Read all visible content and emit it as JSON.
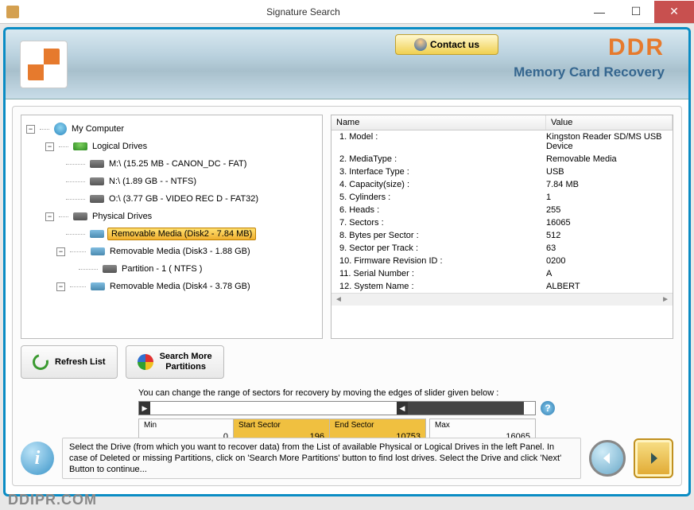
{
  "window": {
    "title": "Signature Search"
  },
  "header": {
    "contact_label": "Contact us",
    "brand": "DDR",
    "brand_sub": "Memory Card Recovery"
  },
  "tree": {
    "root": "My Computer",
    "logical_label": "Logical Drives",
    "logical": [
      "M:\\ (15.25 MB - CANON_DC - FAT)",
      "N:\\ (1.89 GB -  - NTFS)",
      "O:\\ (3.77 GB - VIDEO REC D - FAT32)"
    ],
    "physical_label": "Physical Drives",
    "physical": [
      {
        "label": "Removable Media (Disk2 - 7.84 MB)",
        "selected": true
      },
      {
        "label": "Removable Media (Disk3 - 1.88 GB)",
        "children": [
          "Partition - 1 ( NTFS )"
        ]
      },
      {
        "label": "Removable Media (Disk4 - 3.78 GB)"
      }
    ]
  },
  "details": {
    "columns": {
      "name": "Name",
      "value": "Value"
    },
    "rows": [
      {
        "name": "1. Model :",
        "value": "Kingston Reader     SD/MS USB Device"
      },
      {
        "name": "2. MediaType :",
        "value": "Removable Media"
      },
      {
        "name": "3. Interface Type :",
        "value": "USB"
      },
      {
        "name": "4. Capacity(size) :",
        "value": "7.84 MB"
      },
      {
        "name": "5. Cylinders :",
        "value": "1"
      },
      {
        "name": "6. Heads :",
        "value": "255"
      },
      {
        "name": "7. Sectors :",
        "value": "16065"
      },
      {
        "name": "8. Bytes per Sector :",
        "value": "512"
      },
      {
        "name": "9. Sector per Track :",
        "value": "63"
      },
      {
        "name": "10. Firmware Revision ID :",
        "value": "0200"
      },
      {
        "name": "11. Serial Number :",
        "value": "A"
      },
      {
        "name": "12. System Name :",
        "value": "ALBERT"
      }
    ]
  },
  "buttons": {
    "refresh": "Refresh List",
    "search_more_l1": "Search More",
    "search_more_l2": "Partitions"
  },
  "slider": {
    "instruction": "You can change the range of sectors for recovery by moving the edges of slider given below :",
    "min_label": "Min",
    "min_value": "0",
    "start_label": "Start Sector",
    "start_value": "196",
    "end_label": "End Sector",
    "end_value": "10753",
    "max_label": "Max",
    "max_value": "16065"
  },
  "footer": {
    "text": "Select the Drive (from which you want to recover data) from the List of available Physical or Logical Drives in the left Panel. In case of Deleted or missing Partitions, click on 'Search More Partitions' button to find lost drives. Select the Drive and click 'Next' Button to continue..."
  },
  "watermark": "DDIPR.COM"
}
